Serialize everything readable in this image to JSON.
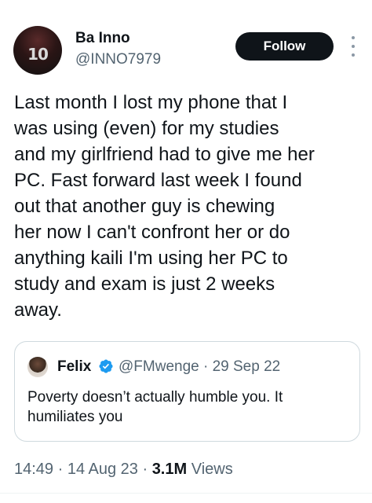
{
  "author": {
    "display_name": "Ba Inno",
    "handle": "@INNO7979",
    "avatar_icon": "profile-avatar",
    "avatar_number": "10"
  },
  "follow_button": {
    "label": "Follow"
  },
  "more_menu": {
    "icon": "more-vertical-icon"
  },
  "tweet": {
    "text": "Last month I lost my phone that I\nwas  using (even)  for my studies\nand my girlfriend had to give me her\nPC. Fast forward last week I found\nout that another guy is chewing\nher now I can't confront her or do\nanything kaili I'm using her PC to\nstudy and exam is just 2 weeks\naway."
  },
  "quoted_tweet": {
    "display_name": "Felix",
    "verified_icon": "verified-badge-icon",
    "verified_color": "#1d9bf0",
    "handle_date": "@FMwenge · 29 Sep 22",
    "text": "Poverty doesn’t actually humble you. It\nhumiliates you"
  },
  "meta": {
    "timestamp": "14:49 · 14 Aug 23 · ",
    "views_count": "3.1M",
    "views_label": " Views"
  },
  "colors": {
    "text_primary": "#0f1419",
    "text_secondary": "#536471",
    "border": "#cfd9de",
    "button_bg": "#0f1419"
  }
}
